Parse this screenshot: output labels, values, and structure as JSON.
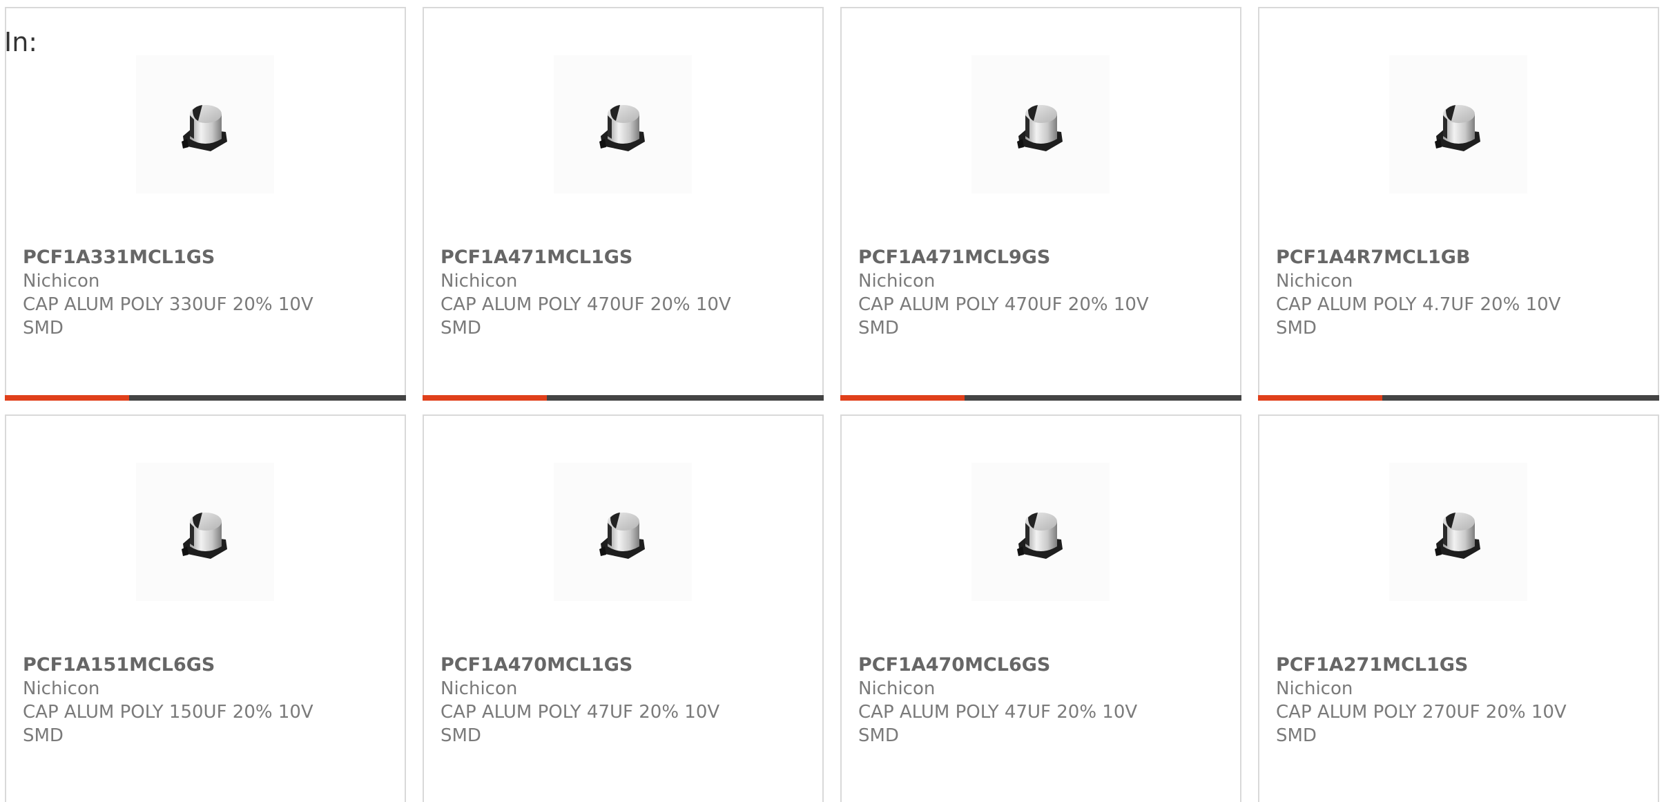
{
  "header": {
    "in_label": "In:"
  },
  "colors": {
    "accent": "#e0401b",
    "bar_track": "#444444",
    "card_border": "#d9d9d9"
  },
  "products": [
    {
      "part_number": "PCF1A331MCL1GS",
      "manufacturer": "Nichicon",
      "description": "CAP ALUM POLY 330UF 20% 10V SMD",
      "icon": "smd-capacitor-image",
      "progress": 0.31,
      "has_bar": true
    },
    {
      "part_number": "PCF1A471MCL1GS",
      "manufacturer": "Nichicon",
      "description": "CAP ALUM POLY 470UF 20% 10V SMD",
      "icon": "smd-capacitor-image",
      "progress": 0.31,
      "has_bar": true
    },
    {
      "part_number": "PCF1A471MCL9GS",
      "manufacturer": "Nichicon",
      "description": "CAP ALUM POLY 470UF 20% 10V SMD",
      "icon": "smd-capacitor-image",
      "progress": 0.31,
      "has_bar": true
    },
    {
      "part_number": "PCF1A4R7MCL1GB",
      "manufacturer": "Nichicon",
      "description": "CAP ALUM POLY 4.7UF 20% 10V SMD",
      "icon": "smd-capacitor-image",
      "progress": 0.31,
      "has_bar": true
    },
    {
      "part_number": "PCF1A151MCL6GS",
      "manufacturer": "Nichicon",
      "description": "CAP ALUM POLY 150UF 20% 10V SMD",
      "icon": "smd-capacitor-image",
      "has_bar": false
    },
    {
      "part_number": "PCF1A470MCL1GS",
      "manufacturer": "Nichicon",
      "description": "CAP ALUM POLY 47UF 20% 10V SMD",
      "icon": "smd-capacitor-image",
      "has_bar": false
    },
    {
      "part_number": "PCF1A470MCL6GS",
      "manufacturer": "Nichicon",
      "description": "CAP ALUM POLY 47UF 20% 10V SMD",
      "icon": "smd-capacitor-image",
      "has_bar": false
    },
    {
      "part_number": "PCF1A271MCL1GS",
      "manufacturer": "Nichicon",
      "description": "CAP ALUM POLY 270UF 20% 10V SMD",
      "icon": "smd-capacitor-image",
      "has_bar": false
    }
  ]
}
